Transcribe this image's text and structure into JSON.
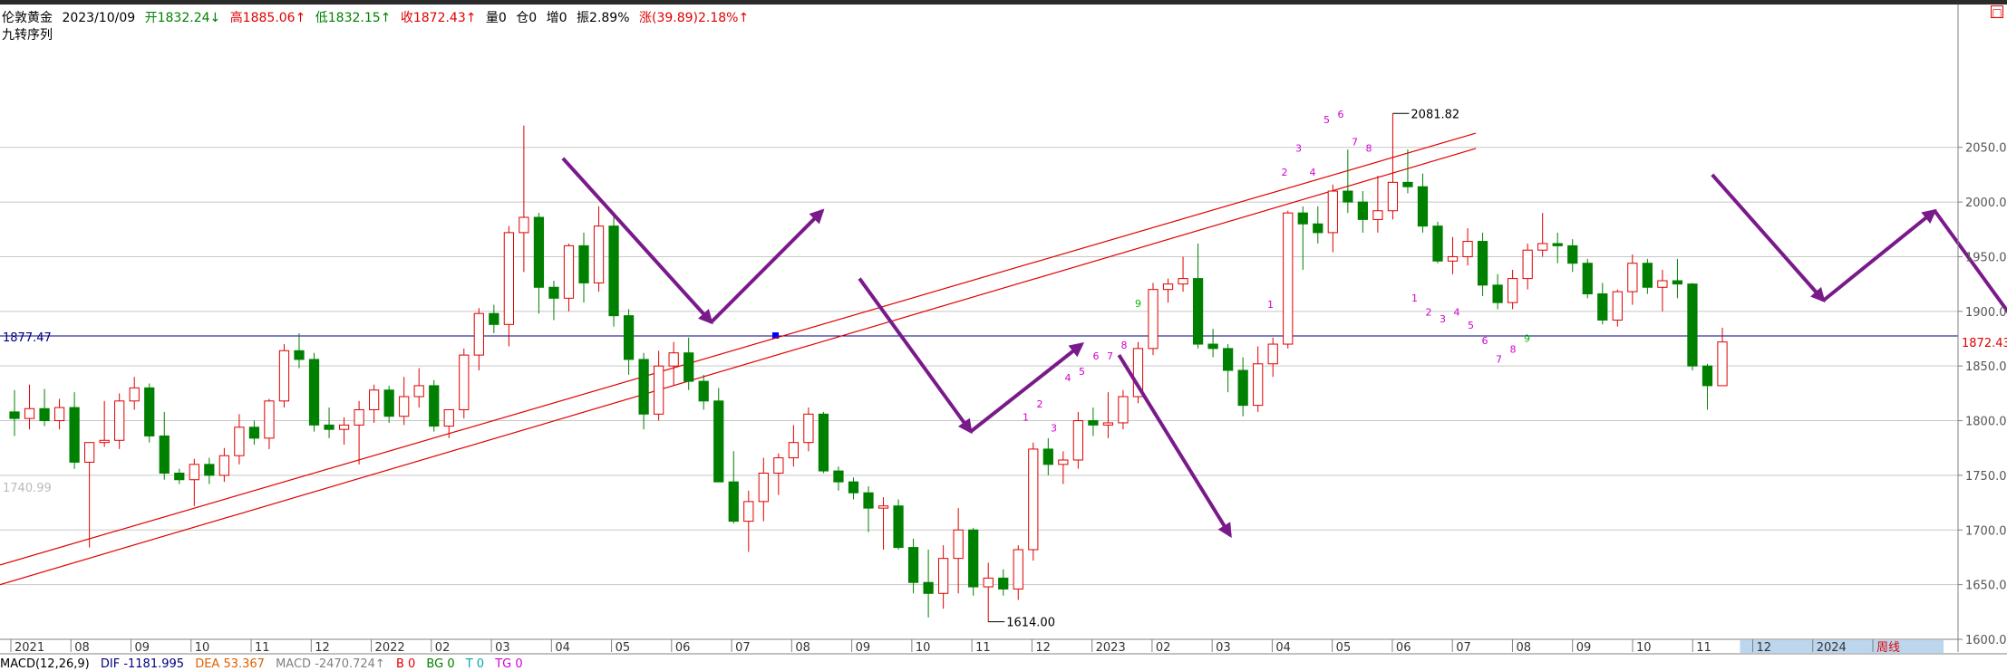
{
  "header": {
    "instrument": "伦敦黄金",
    "date": "2023/10/09",
    "open": "开1832.24↓",
    "high": "高1885.06↑",
    "low": "低1832.15↑",
    "close": "收1872.43↑",
    "volume": "量0",
    "position": "仓0",
    "increase": "增0",
    "amplitude": "振2.89%",
    "change": "涨(39.89)2.18%↑",
    "corner_label": "□"
  },
  "subtitle": "九转序列",
  "macd": {
    "name": "MACD(12,26,9)",
    "dif": "DIF -1181.995",
    "dea": "DEA 53.367",
    "macd": "MACD -2470.724↑",
    "b": "B 0",
    "bg": "BG 0",
    "t": "T 0",
    "tg": "TG 0"
  },
  "colors": {
    "up": "#e00000",
    "down": "#008000",
    "arrow": "#7a1a8a",
    "grid": "#c8c8c8",
    "trendline": "#e00000",
    "hline": "#000080",
    "nine_turn": "#d000d0",
    "nine_turn_green": "#00c000",
    "axis_highlight": "#bcd6ee"
  },
  "chart_data": {
    "type": "candlestick",
    "title": "伦敦黄金",
    "ylim": [
      1600,
      2150
    ],
    "y_ticks": [
      "1600.00",
      "1650.00",
      "1700.00",
      "1750.00",
      "1800.00",
      "1850.00",
      "1900.00",
      "1950.00",
      "2000.00",
      "2050.00"
    ],
    "x_axis_labels": [
      "2021",
      "08",
      "09",
      "10",
      "11",
      "12",
      "2022",
      "02",
      "03",
      "04",
      "05",
      "06",
      "07",
      "08",
      "09",
      "10",
      "11",
      "12",
      "2023",
      "02",
      "03",
      "04",
      "05",
      "06",
      "07",
      "08",
      "09",
      "10",
      "11",
      "12",
      "2024",
      "周线"
    ],
    "current_price_label": "1872.43",
    "hline_value": 1877.47,
    "hline_label": "1877.47",
    "faded_value_label": "1740.99",
    "peak_label": "2081.82",
    "trough_label": "1614.00",
    "candles": [
      [
        1808,
        1828,
        1786,
        1802
      ],
      [
        1802,
        1833,
        1792,
        1811
      ],
      [
        1811,
        1829,
        1795,
        1800
      ],
      [
        1800,
        1820,
        1792,
        1812
      ],
      [
        1812,
        1826,
        1756,
        1762
      ],
      [
        1762,
        1778,
        1684,
        1780
      ],
      [
        1780,
        1818,
        1776,
        1782
      ],
      [
        1782,
        1825,
        1774,
        1818
      ],
      [
        1818,
        1840,
        1810,
        1830
      ],
      [
        1830,
        1834,
        1780,
        1786
      ],
      [
        1786,
        1808,
        1746,
        1752
      ],
      [
        1752,
        1756,
        1742,
        1746
      ],
      [
        1746,
        1765,
        1722,
        1760
      ],
      [
        1760,
        1766,
        1742,
        1750
      ],
      [
        1750,
        1775,
        1744,
        1768
      ],
      [
        1768,
        1806,
        1760,
        1794
      ],
      [
        1794,
        1800,
        1778,
        1784
      ],
      [
        1784,
        1820,
        1774,
        1818
      ],
      [
        1818,
        1870,
        1812,
        1864
      ],
      [
        1864,
        1880,
        1848,
        1856
      ],
      [
        1856,
        1862,
        1790,
        1796
      ],
      [
        1796,
        1812,
        1784,
        1792
      ],
      [
        1792,
        1803,
        1778,
        1796
      ],
      [
        1796,
        1818,
        1760,
        1810
      ],
      [
        1810,
        1833,
        1798,
        1828
      ],
      [
        1828,
        1832,
        1798,
        1804
      ],
      [
        1804,
        1840,
        1796,
        1822
      ],
      [
        1822,
        1848,
        1812,
        1832
      ],
      [
        1832,
        1837,
        1790,
        1795
      ],
      [
        1795,
        1806,
        1784,
        1810
      ],
      [
        1810,
        1866,
        1802,
        1860
      ],
      [
        1860,
        1903,
        1846,
        1898
      ],
      [
        1898,
        1906,
        1880,
        1888
      ],
      [
        1888,
        1978,
        1868,
        1972
      ],
      [
        1972,
        2070,
        1936,
        1986
      ],
      [
        1986,
        1990,
        1898,
        1922
      ],
      [
        1922,
        1928,
        1892,
        1912
      ],
      [
        1912,
        1962,
        1900,
        1960
      ],
      [
        1960,
        1972,
        1908,
        1926
      ],
      [
        1926,
        1996,
        1918,
        1978
      ],
      [
        1978,
        1990,
        1886,
        1896
      ],
      [
        1896,
        1902,
        1842,
        1856
      ],
      [
        1856,
        1862,
        1792,
        1806
      ],
      [
        1806,
        1864,
        1800,
        1850
      ],
      [
        1850,
        1872,
        1832,
        1862
      ],
      [
        1862,
        1876,
        1828,
        1836
      ],
      [
        1836,
        1842,
        1810,
        1818
      ],
      [
        1818,
        1830,
        1770,
        1744
      ],
      [
        1744,
        1772,
        1706,
        1708
      ],
      [
        1708,
        1736,
        1680,
        1726
      ],
      [
        1726,
        1766,
        1708,
        1752
      ],
      [
        1752,
        1770,
        1732,
        1766
      ],
      [
        1766,
        1796,
        1758,
        1780
      ],
      [
        1780,
        1812,
        1772,
        1806
      ],
      [
        1806,
        1808,
        1752,
        1754
      ],
      [
        1754,
        1758,
        1736,
        1744
      ],
      [
        1744,
        1748,
        1728,
        1734
      ],
      [
        1734,
        1740,
        1698,
        1720
      ],
      [
        1720,
        1730,
        1682,
        1722
      ],
      [
        1722,
        1728,
        1682,
        1684
      ],
      [
        1684,
        1692,
        1642,
        1652
      ],
      [
        1652,
        1682,
        1620,
        1642
      ],
      [
        1642,
        1686,
        1628,
        1674
      ],
      [
        1674,
        1720,
        1642,
        1700
      ],
      [
        1700,
        1702,
        1640,
        1648
      ],
      [
        1648,
        1670,
        1616,
        1656
      ],
      [
        1656,
        1664,
        1640,
        1646
      ],
      [
        1646,
        1686,
        1636,
        1682
      ],
      [
        1682,
        1780,
        1672,
        1774
      ],
      [
        1774,
        1784,
        1750,
        1760
      ],
      [
        1760,
        1772,
        1742,
        1764
      ],
      [
        1764,
        1808,
        1756,
        1800
      ],
      [
        1800,
        1812,
        1786,
        1796
      ],
      [
        1796,
        1826,
        1784,
        1798
      ],
      [
        1798,
        1828,
        1792,
        1822
      ],
      [
        1822,
        1872,
        1816,
        1866
      ],
      [
        1866,
        1926,
        1860,
        1920
      ],
      [
        1920,
        1930,
        1908,
        1925
      ],
      [
        1925,
        1950,
        1918,
        1930
      ],
      [
        1930,
        1962,
        1866,
        1870
      ],
      [
        1870,
        1884,
        1858,
        1866
      ],
      [
        1866,
        1870,
        1826,
        1846
      ],
      [
        1846,
        1858,
        1804,
        1814
      ],
      [
        1814,
        1868,
        1808,
        1852
      ],
      [
        1852,
        1876,
        1840,
        1870
      ],
      [
        1870,
        1992,
        1866,
        1990
      ],
      [
        1990,
        1996,
        1938,
        1980
      ],
      [
        1980,
        1996,
        1962,
        1972
      ],
      [
        1972,
        2016,
        1954,
        2010
      ],
      [
        2010,
        2048,
        1990,
        2000
      ],
      [
        2000,
        2010,
        1972,
        1984
      ],
      [
        1984,
        2024,
        1972,
        1992
      ],
      [
        1992,
        2081,
        1984,
        2018
      ],
      [
        2018,
        2048,
        2008,
        2014
      ],
      [
        2014,
        2026,
        1972,
        1978
      ],
      [
        1978,
        1982,
        1944,
        1946
      ],
      [
        1946,
        1968,
        1934,
        1950
      ],
      [
        1950,
        1976,
        1942,
        1964
      ],
      [
        1964,
        1972,
        1914,
        1924
      ],
      [
        1924,
        1934,
        1902,
        1908
      ],
      [
        1908,
        1938,
        1902,
        1930
      ],
      [
        1930,
        1962,
        1920,
        1956
      ],
      [
        1956,
        1990,
        1950,
        1962
      ],
      [
        1962,
        1972,
        1944,
        1960
      ],
      [
        1960,
        1966,
        1936,
        1944
      ],
      [
        1944,
        1948,
        1912,
        1916
      ],
      [
        1916,
        1926,
        1888,
        1892
      ],
      [
        1892,
        1920,
        1886,
        1918
      ],
      [
        1918,
        1952,
        1906,
        1944
      ],
      [
        1944,
        1948,
        1916,
        1922
      ],
      [
        1922,
        1938,
        1900,
        1928
      ],
      [
        1928,
        1948,
        1912,
        1925
      ],
      [
        1925,
        1926,
        1846,
        1850
      ],
      [
        1850,
        1852,
        1810,
        1832
      ],
      [
        1832,
        1885,
        1832,
        1872
      ]
    ],
    "trend_channel": [
      [
        1668,
        1838
      ],
      [
        1650,
        1825
      ],
      [
        2063,
        2083
      ],
      [
        2049,
        2070
      ]
    ],
    "arrows": [
      [
        [
          1,
          2040
        ],
        [
          5,
          1890
        ]
      ],
      [
        [
          5,
          1890
        ],
        [
          8,
          1992
        ]
      ],
      [
        [
          9,
          1930
        ],
        [
          12,
          1790
        ]
      ],
      [
        [
          12,
          1790
        ],
        [
          15,
          1870
        ]
      ],
      [
        [
          16,
          1860
        ],
        [
          19,
          1695
        ]
      ],
      [
        [
          32,
          2025
        ],
        [
          35,
          1910
        ]
      ],
      [
        [
          35,
          1910
        ],
        [
          38,
          1992
        ]
      ],
      [
        [
          38,
          1992
        ],
        [
          42,
          1805
        ]
      ],
      [
        [
          42,
          1805
        ],
        [
          44,
          1882
        ]
      ],
      [
        [
          44,
          1882
        ],
        [
          46,
          1716
        ]
      ]
    ],
    "nine_turn_labels": [
      {
        "text": "1",
        "x": 0,
        "y": 1800,
        "color": "nine_turn"
      },
      {
        "text": "2",
        "x": 0,
        "y": 1812,
        "color": "nine_turn"
      },
      {
        "text": "3",
        "x": 0,
        "y": 1790,
        "color": "nine_turn"
      },
      {
        "text": "4",
        "x": 0,
        "y": 1836,
        "color": "nine_turn"
      },
      {
        "text": "5",
        "x": 0,
        "y": 1842,
        "color": "nine_turn"
      },
      {
        "text": "6",
        "x": 0,
        "y": 1856,
        "color": "nine_turn"
      },
      {
        "text": "7",
        "x": 0,
        "y": 1856,
        "color": "nine_turn"
      },
      {
        "text": "8",
        "x": 0,
        "y": 1866,
        "color": "nine_turn"
      },
      {
        "text": "9",
        "x": 0,
        "y": 1904,
        "color": "nine_turn_green"
      },
      {
        "text": "1",
        "x": 0,
        "y": 1903,
        "color": "nine_turn"
      },
      {
        "text": "2",
        "x": 0,
        "y": 2024,
        "color": "nine_turn"
      },
      {
        "text": "3",
        "x": 0,
        "y": 2046,
        "color": "nine_turn"
      },
      {
        "text": "4",
        "x": 0,
        "y": 2024,
        "color": "nine_turn"
      },
      {
        "text": "5",
        "x": 0,
        "y": 2072,
        "color": "nine_turn"
      },
      {
        "text": "6",
        "x": 0,
        "y": 2077,
        "color": "nine_turn"
      },
      {
        "text": "7",
        "x": 0,
        "y": 2052,
        "color": "nine_turn"
      },
      {
        "text": "8",
        "x": 0,
        "y": 2046,
        "color": "nine_turn"
      },
      {
        "text": "1",
        "x": 0,
        "y": 1909,
        "color": "nine_turn"
      },
      {
        "text": "2",
        "x": 0,
        "y": 1896,
        "color": "nine_turn"
      },
      {
        "text": "3",
        "x": 0,
        "y": 1890,
        "color": "nine_turn"
      },
      {
        "text": "4",
        "x": 0,
        "y": 1896,
        "color": "nine_turn"
      },
      {
        "text": "5",
        "x": 0,
        "y": 1884,
        "color": "nine_turn"
      },
      {
        "text": "6",
        "x": 0,
        "y": 1870,
        "color": "nine_turn"
      },
      {
        "text": "7",
        "x": 0,
        "y": 1853,
        "color": "nine_turn"
      },
      {
        "text": "8",
        "x": 0,
        "y": 1862,
        "color": "nine_turn"
      },
      {
        "text": "9",
        "x": 0,
        "y": 1872,
        "color": "nine_turn_green"
      }
    ]
  }
}
